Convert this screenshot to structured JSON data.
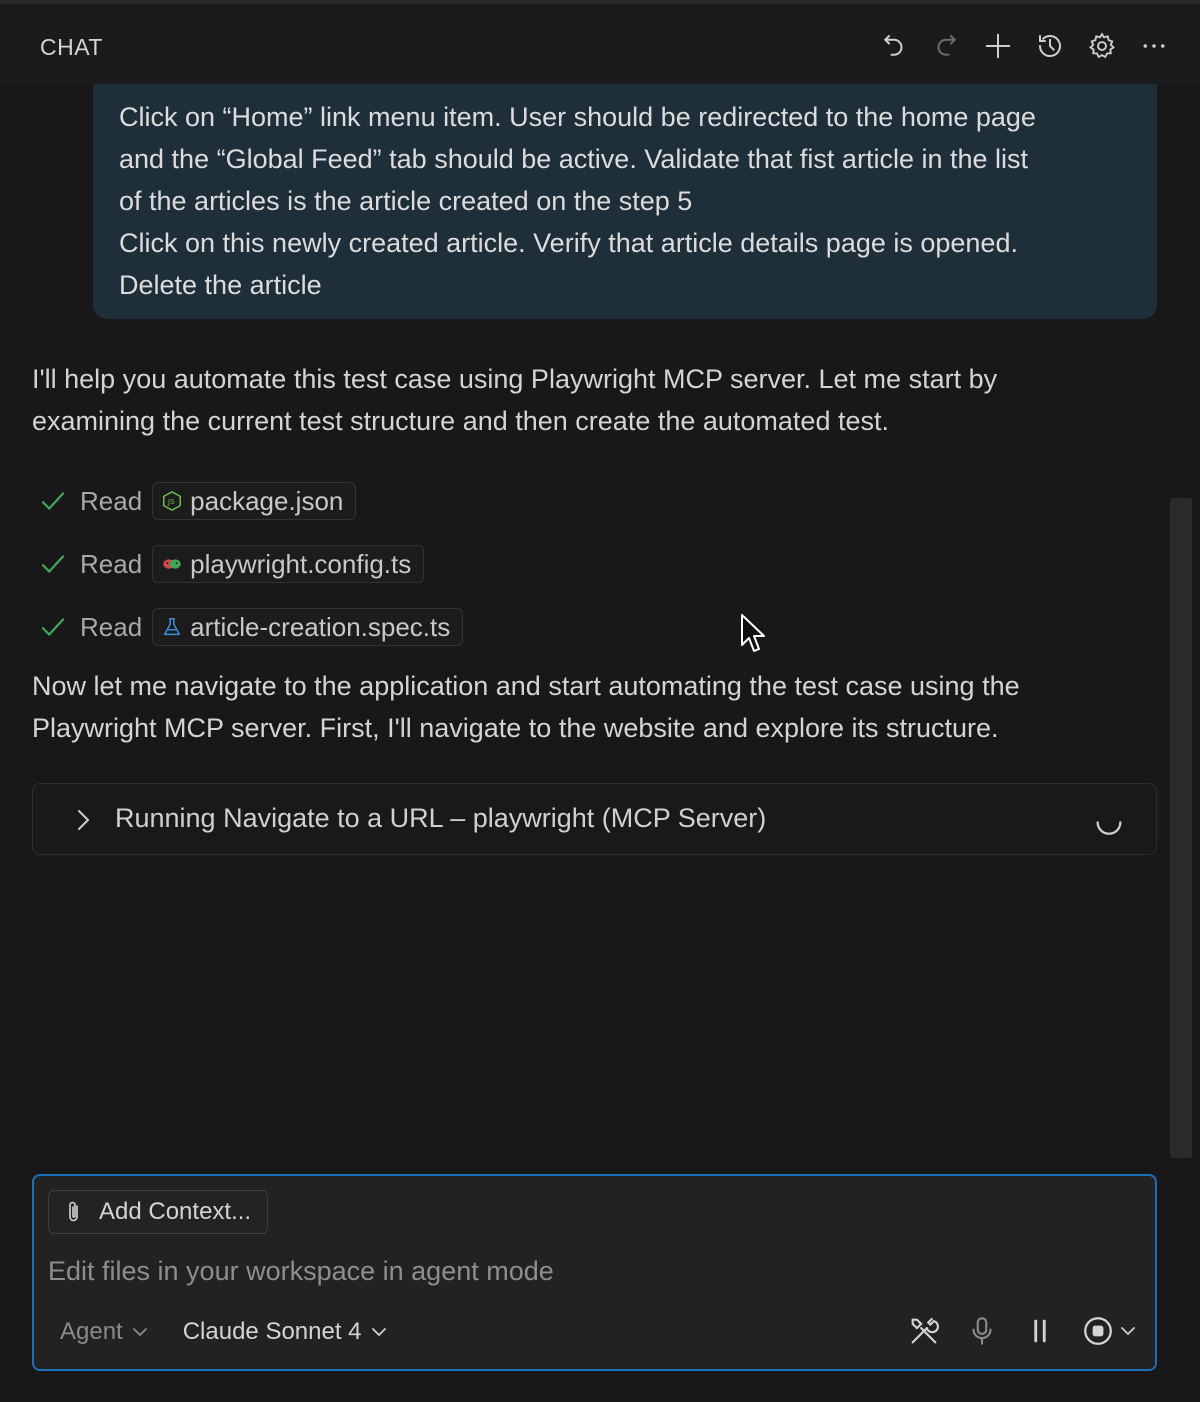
{
  "header": {
    "title": "CHAT",
    "actions": [
      "undo-icon",
      "redo-icon",
      "new-chat-icon",
      "history-icon",
      "settings-icon",
      "more-icon"
    ]
  },
  "user_message": {
    "lines": [
      "Click on “Home” link menu item. User should be redirected to the home page",
      "and the “Global Feed” tab should be active. Validate that fist article in the list",
      "of the articles is the article created on the step 5",
      "Click on this newly created article. Verify that article details page is opened.",
      "Delete the article"
    ]
  },
  "response": {
    "para1_lines": [
      "I'll help you automate this test case using Playwright MCP server. Let me start by",
      "examining the current test structure and then create the automated test."
    ],
    "reads": [
      {
        "label": "Read",
        "file": "package.json",
        "icon": "nodejs-icon"
      },
      {
        "label": "Read",
        "file": "playwright.config.ts",
        "icon": "playwright-icon"
      },
      {
        "label": "Read",
        "file": "article-creation.spec.ts",
        "icon": "flask-icon"
      }
    ],
    "para2_lines": [
      "Now let me navigate to the application and start automating the test case using the",
      "Playwright MCP server. First, I'll navigate to the website and explore its structure."
    ],
    "tool_call": {
      "text": "Running Navigate to a URL – playwright (MCP Server)"
    }
  },
  "input": {
    "add_context_label": "Add Context...",
    "placeholder": "Edit files in your workspace in agent mode",
    "mode": "Agent",
    "model": "Claude Sonnet 4"
  },
  "colors": {
    "background": "#181818",
    "user_bubble": "#1f2f3a",
    "accent_border": "#1e6fba",
    "check": "#3fa65a"
  }
}
